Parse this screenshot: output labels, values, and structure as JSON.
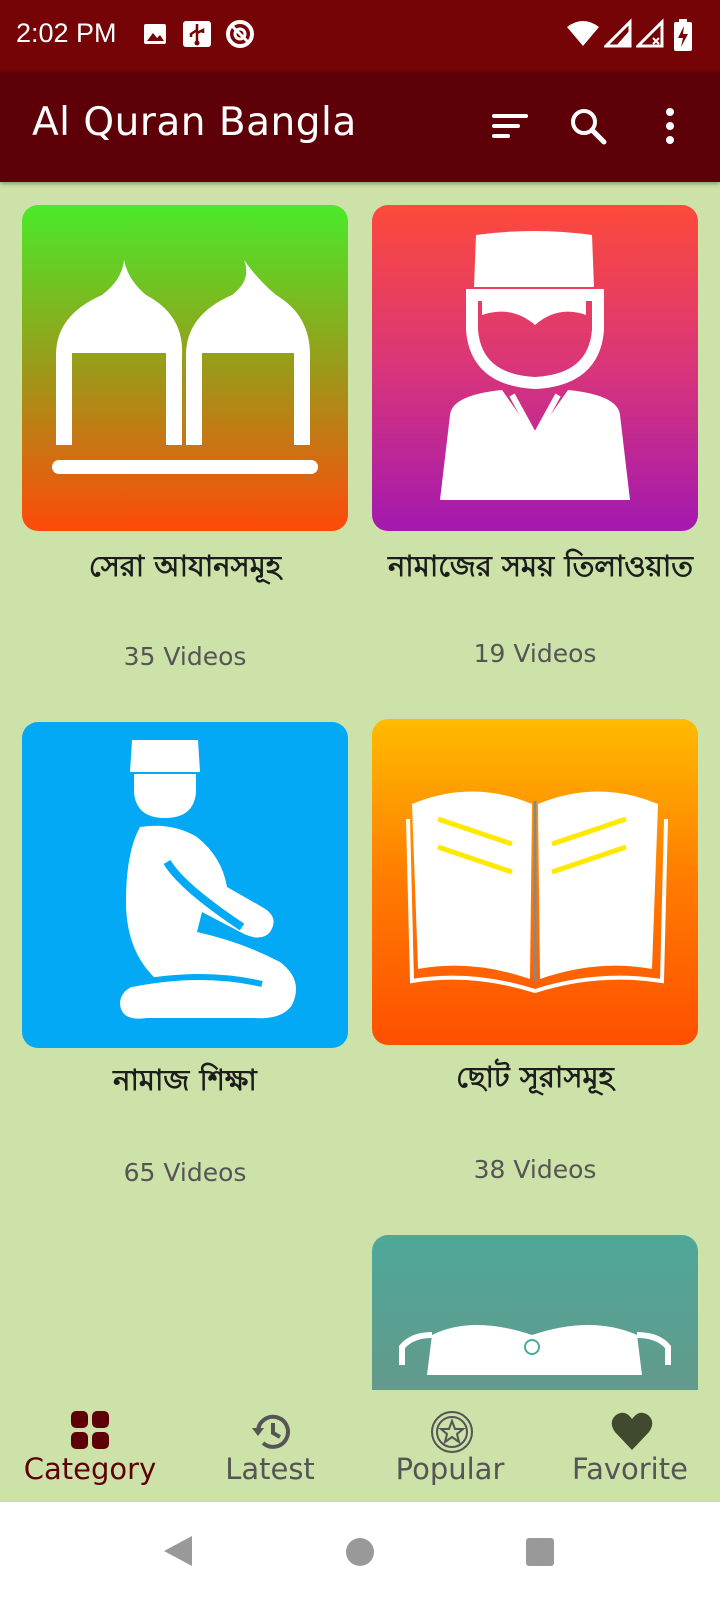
{
  "status_bar": {
    "time": "2:02 PM"
  },
  "app_bar": {
    "title": "Al Quran Bangla"
  },
  "categories": [
    {
      "name": "সেরা আযানসমূহ",
      "count": "35 Videos"
    },
    {
      "name": "নামাজের সময় তিলাওয়াত",
      "count": "19 Videos"
    },
    {
      "name": "নামাজ শিক্ষা",
      "count": "65 Videos"
    },
    {
      "name": "ছোট সূরাসমূহ",
      "count": "38 Videos"
    }
  ],
  "bottom_nav": {
    "category": "Category",
    "latest": "Latest",
    "popular": "Popular",
    "favorite": "Favorite"
  },
  "colors": {
    "status_bar": "#760306",
    "app_bar": "#5e0007",
    "background": "#cde2a8",
    "active_nav": "#5e0007"
  }
}
